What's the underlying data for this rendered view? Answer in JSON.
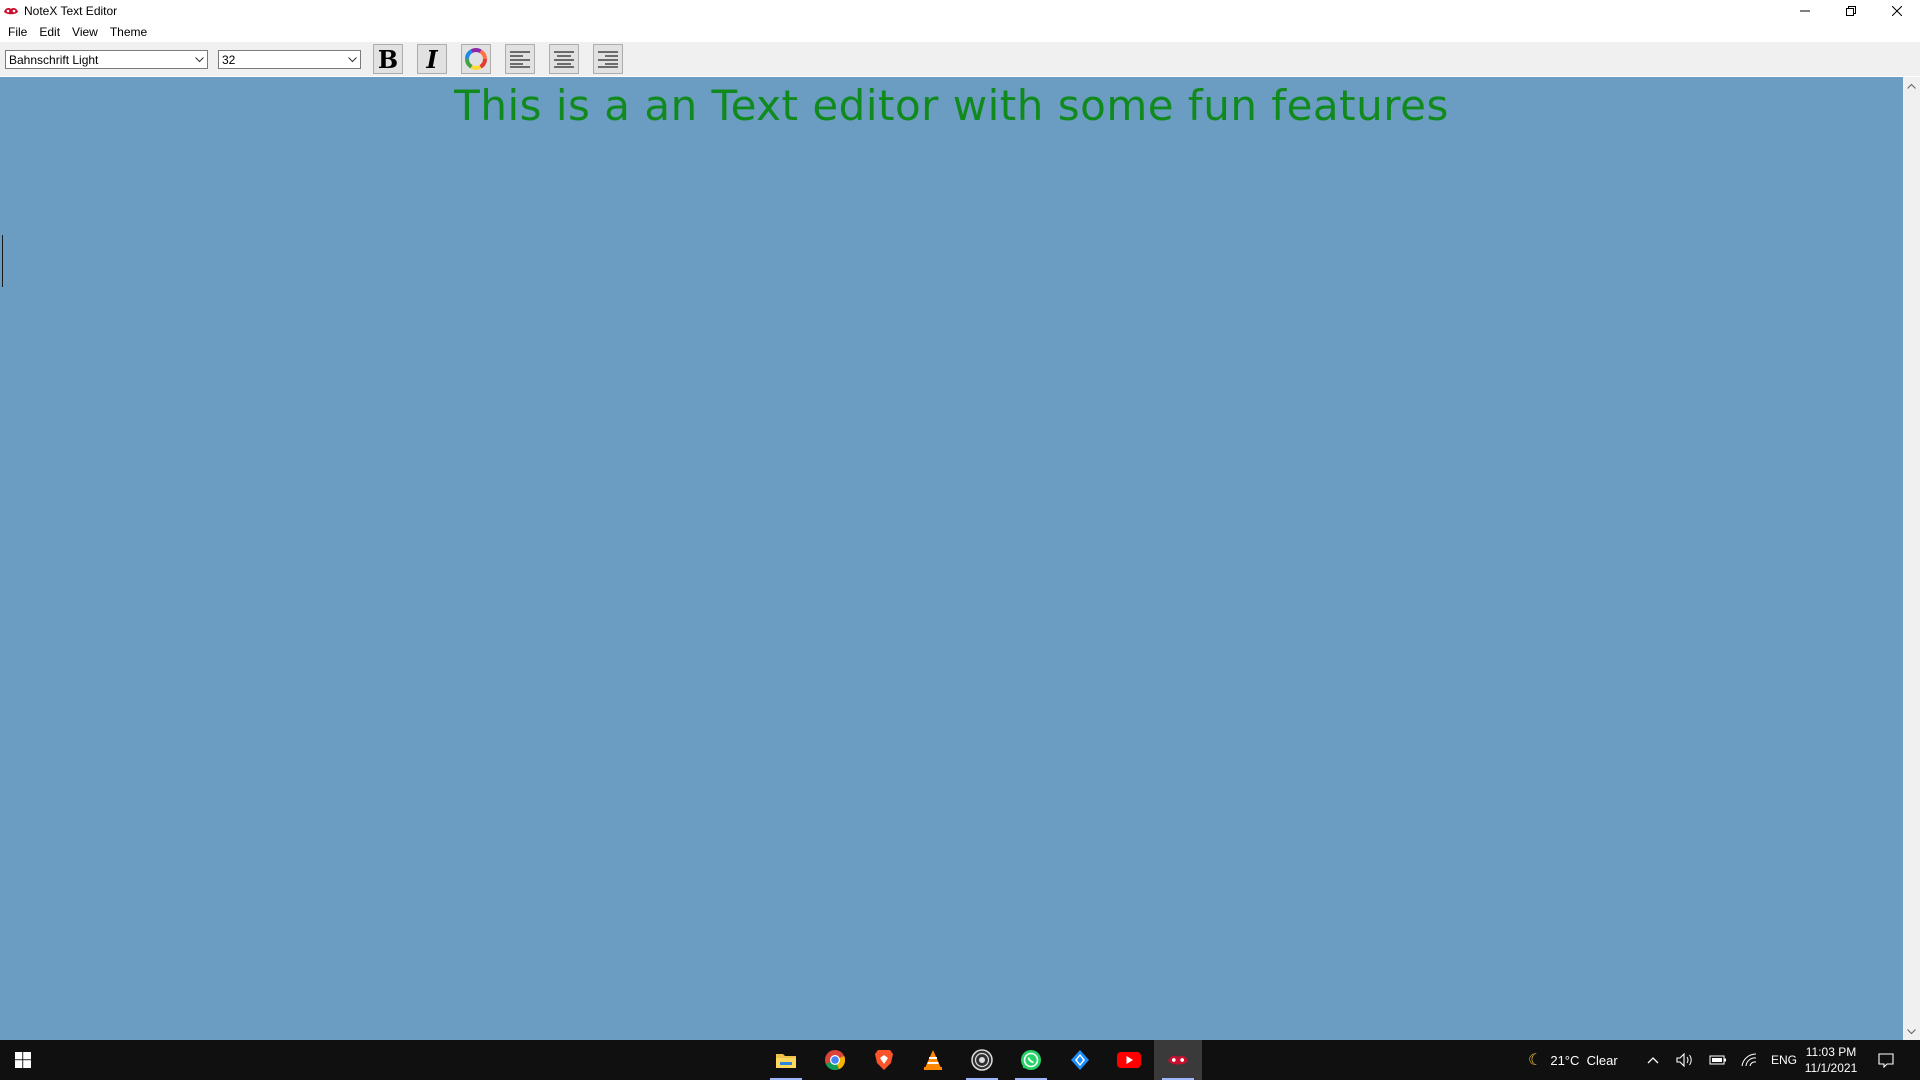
{
  "window": {
    "title": "NoteX Text Editor"
  },
  "menu": [
    "File",
    "Edit",
    "View",
    "Theme"
  ],
  "toolbar": {
    "font_family": "Bahnschrift Light",
    "font_size": "32",
    "bold_label": "B",
    "italic_label": "I",
    "icons": [
      "bold-icon",
      "italic-icon",
      "color-wheel-icon",
      "align-left-icon",
      "align-center-icon",
      "align-right-icon"
    ]
  },
  "editor": {
    "text": "This is a an Text editor with some fun features",
    "text_color": "#118a1d",
    "background": "#6b9dc2"
  },
  "taskbar": {
    "apps": [
      "file-explorer-icon",
      "chrome-icon",
      "brave-icon",
      "vlc-icon",
      "obs-icon",
      "whatsapp-icon",
      "messenger-icon",
      "youtube-icon",
      "notex-icon"
    ],
    "weather": "21°C  Clear",
    "language": "ENG",
    "time": "11:03 PM",
    "date": "11/1/2021"
  }
}
